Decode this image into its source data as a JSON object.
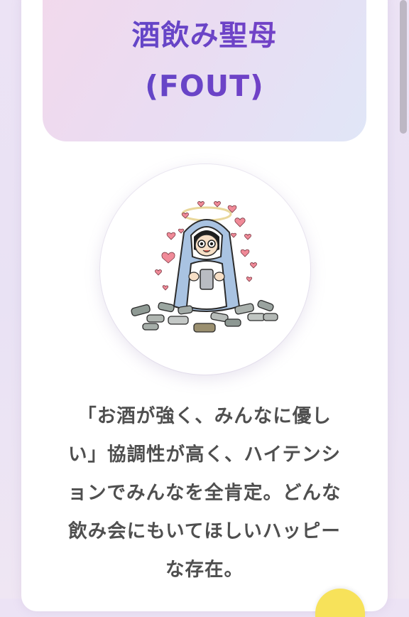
{
  "result": {
    "title_jp": "酒飲み聖母",
    "title_code": "(FOUT)",
    "description_lines": [
      "「お酒が強く、みんなに優し",
      "い」協調性が高く、ハイテンシ",
      "ョンでみんなを全肯定。どんな",
      "飲み会にもいてほしいハッピー",
      "な存在。"
    ]
  },
  "colors": {
    "title_gradient_start": "#5a48c8",
    "title_gradient_end": "#7b3fc6",
    "header_bg_pink": "#f2d9ec",
    "header_bg_blue": "#e0e6f7",
    "text": "#4f4f4f",
    "badge": "#f7e25a"
  },
  "icons": {
    "illustration": "drinking-madonna-character-illustration"
  }
}
